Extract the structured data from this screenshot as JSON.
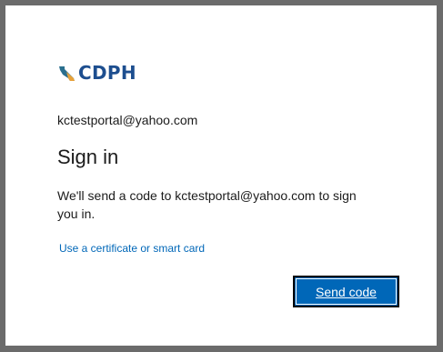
{
  "logo": {
    "text": "CDPH",
    "icon": "california-state-shape-icon",
    "color": "#1d4e8f"
  },
  "identity": {
    "email": "kctestportal@yahoo.com"
  },
  "heading": {
    "title": "Sign in"
  },
  "body": {
    "description": "We'll send a code to kctestportal@yahoo.com to sign you in."
  },
  "links": {
    "certificate": "Use a certificate or smart card"
  },
  "actions": {
    "send_code": "Send code"
  },
  "colors": {
    "backdrop": "#6b6b6b",
    "card": "#ffffff",
    "accent": "#0067b8",
    "text": "#1b1b1b"
  }
}
